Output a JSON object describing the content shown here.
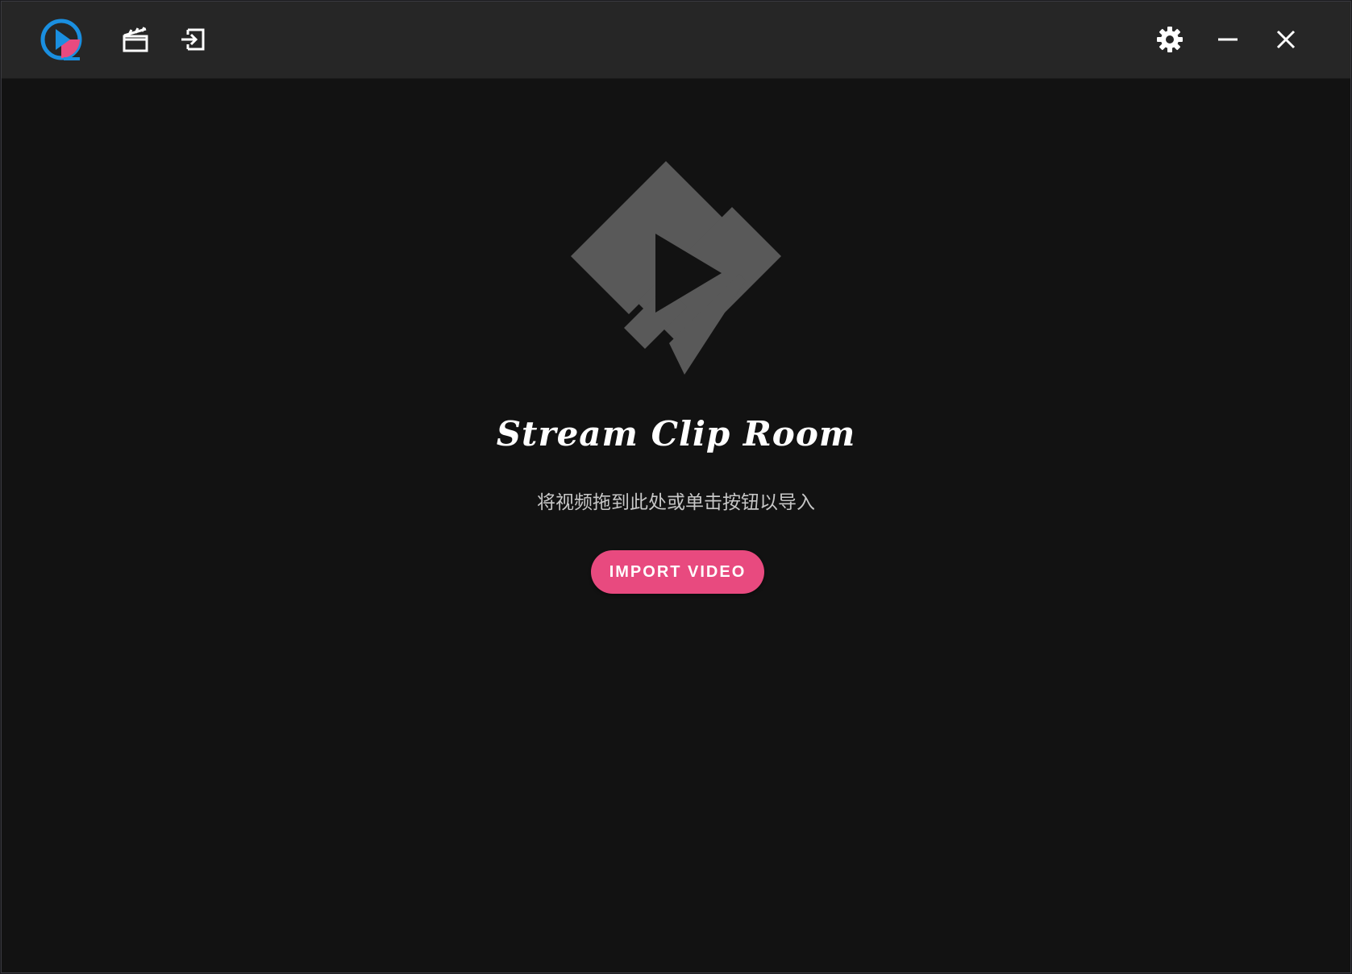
{
  "window": {
    "app_name": "Stream Clip Room",
    "hint_text": "将视频拖到此处或单击按钮以导入",
    "import_button_label": "IMPORT VIDEO"
  },
  "titlebar": {
    "logo_icon": "app-logo-icon",
    "left_buttons": [
      {
        "name": "clapperboard-icon",
        "title": "Videos"
      },
      {
        "name": "import-icon",
        "title": "Import"
      }
    ],
    "right_buttons": [
      {
        "name": "gear-icon"
      },
      {
        "name": "minimize-icon"
      },
      {
        "name": "close-icon"
      }
    ]
  },
  "colors": {
    "accent": "#e84a7f",
    "logo_blue": "#1a8fe0",
    "logo_pink": "#e84a7f",
    "titlebar_bg": "#262626",
    "content_bg": "#121212",
    "hero_icon": "#595959"
  }
}
